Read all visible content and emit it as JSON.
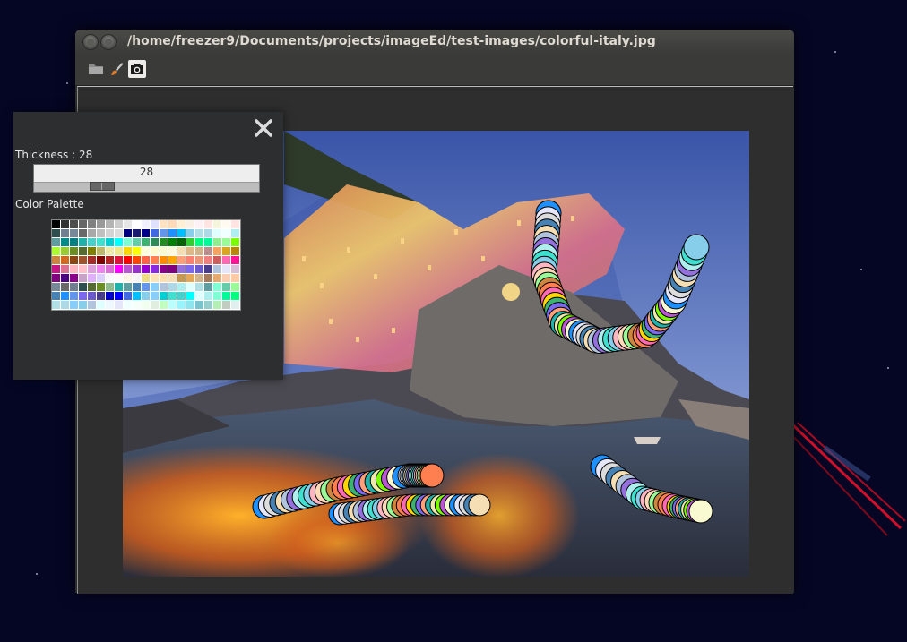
{
  "window": {
    "title": "/home/freezer9/Documents/projects/imageEd/test-images/colorful-italy.jpg"
  },
  "toolbar": {
    "tools": [
      {
        "name": "open-folder-icon",
        "active": false
      },
      {
        "name": "paintbrush-icon",
        "active": false
      },
      {
        "name": "camera-icon",
        "active": true
      }
    ]
  },
  "brush_panel": {
    "thickness_label": "Thickness : 28",
    "thickness_value": "28",
    "thickness": 28,
    "thickness_max": 100,
    "palette_label": "Color Palette"
  },
  "colors": {
    "desktop": "#050624",
    "window_bg": "#2c2c2c",
    "panel_bg": "#2d2e30"
  },
  "palette_colors": [
    "#000000",
    "#333333",
    "#4d4d4d",
    "#666666",
    "#808080",
    "#999999",
    "#b3b3b3",
    "#cccccc",
    "#e6e6e6",
    "#ffffff",
    "#f0f0ff",
    "#e0e0ff",
    "#ffe4c4",
    "#ffdab9",
    "#ffefd5",
    "#faf0e6",
    "#fff0f5",
    "#ffe4e1",
    "#f5f5dc",
    "#fffaf0",
    "#ffe4e1",
    "#2f4f4f",
    "#708090",
    "#778899",
    "#696969",
    "#a9a9a9",
    "#c0c0c0",
    "#d3d3d3",
    "#dcdcdc",
    "#000080",
    "#191970",
    "#00008b",
    "#4169e1",
    "#6495ed",
    "#1e90ff",
    "#00bfff",
    "#87ceeb",
    "#b0e0e6",
    "#add8e6",
    "#e0ffff",
    "#f0ffff",
    "#afeeee",
    "#5f9ea0",
    "#008b8b",
    "#008080",
    "#20b2aa",
    "#48d1cc",
    "#40e0d0",
    "#00ced1",
    "#00ffff",
    "#7fffd4",
    "#66cdaa",
    "#3cb371",
    "#2e8b57",
    "#228b22",
    "#008000",
    "#006400",
    "#32cd32",
    "#00ff7f",
    "#00fa9a",
    "#90ee90",
    "#98fb98",
    "#7cfc00",
    "#adff2f",
    "#9acd32",
    "#6b8e23",
    "#556b2f",
    "#808000",
    "#bdb76b",
    "#eee8aa",
    "#f0e68c",
    "#ffd700",
    "#ffff00",
    "#ffffe0",
    "#fffacd",
    "#fafad2",
    "#fff8dc",
    "#f5deb3",
    "#deb887",
    "#d2b48c",
    "#bc8f8f",
    "#f4a460",
    "#daa520",
    "#b8860b",
    "#cd853f",
    "#d2691e",
    "#8b4513",
    "#a0522d",
    "#a52a2a",
    "#800000",
    "#b22222",
    "#dc143c",
    "#ff0000",
    "#ff4500",
    "#ff6347",
    "#ff7f50",
    "#ff8c00",
    "#ffa500",
    "#ffa07a",
    "#fa8072",
    "#e9967a",
    "#f08080",
    "#cd5c5c",
    "#ff69b4",
    "#ff1493",
    "#c71585",
    "#db7093",
    "#ffb6c1",
    "#ffc0cb",
    "#dda0dd",
    "#ee82ee",
    "#da70d6",
    "#ff00ff",
    "#ba55d3",
    "#9932cc",
    "#9400d3",
    "#8a2be2",
    "#8b008b",
    "#800080",
    "#9370db",
    "#7b68ee",
    "#6a5acd",
    "#483d8b",
    "#b0c4de",
    "#e6e6fa",
    "#d8bfd8",
    "#800080",
    "#4b0082",
    "#8b008b",
    "#c8a2c8",
    "#e0b0ff",
    "#dcd0ff",
    "#f8f8ff",
    "#fffafa",
    "#fdf5e6",
    "#f5f5f5",
    "#eedd82",
    "#ffe4b5",
    "#ffdead",
    "#f5deb3",
    "#c39953",
    "#e3a857",
    "#d2b48c",
    "#a67b5b",
    "#e5aa70",
    "#fbceb1",
    "#ffcba4",
    "#778899",
    "#696969",
    "#708090",
    "#2f4f4f",
    "#556b2f",
    "#6b8e23",
    "#8fbc8f",
    "#20b2aa",
    "#5f9ea0",
    "#4682b4",
    "#6495ed",
    "#87cefa",
    "#b0c4de",
    "#add8e6",
    "#afeeee",
    "#e0ffff",
    "#b0e0e6",
    "#5f9ea0",
    "#7fffd4",
    "#66cdaa",
    "#98fb98",
    "#4682b4",
    "#1e90ff",
    "#6495ed",
    "#7b68ee",
    "#6a5acd",
    "#483d8b",
    "#0000cd",
    "#0000ff",
    "#4169e1",
    "#00bfff",
    "#87ceeb",
    "#87cefa",
    "#00ced1",
    "#40e0d0",
    "#48d1cc",
    "#00ffff",
    "#e0ffff",
    "#afeeee",
    "#7fffd4",
    "#00fa9a",
    "#00ff7f",
    "#b0e0e6",
    "#add8e6",
    "#87cefa",
    "#87ceeb",
    "#b0c4de",
    "#e0ffff",
    "#f0f8ff",
    "#e6e6fa",
    "#f0ffff",
    "#f5fffa",
    "#f0fff0",
    "#e0eee0",
    "#c1ffc1",
    "#bbffff",
    "#98f5ff",
    "#8ee5ee",
    "#7ac5cd",
    "#96cdcd",
    "#b4eeb4",
    "#c1cdc1",
    "#e0eeee"
  ],
  "strokes": {
    "a_palette": [
      "#1e90ff",
      "#7b68ee",
      "#ffdab9",
      "#f5deb3",
      "#7cfc00",
      "#ff69b4",
      "#40e0d0",
      "#e6e6fa",
      "#ffa07a",
      "#98fb98",
      "#b0c4de",
      "#ba55d3",
      "#ffd700",
      "#87ceeb",
      "#dcdcdc",
      "#20b2aa",
      "#cd853f",
      "#9370db",
      "#fafad2",
      "#3cb371",
      "#ffb6c1",
      "#4682b4",
      "#eee8aa",
      "#ff7f50",
      "#afeeee"
    ]
  }
}
